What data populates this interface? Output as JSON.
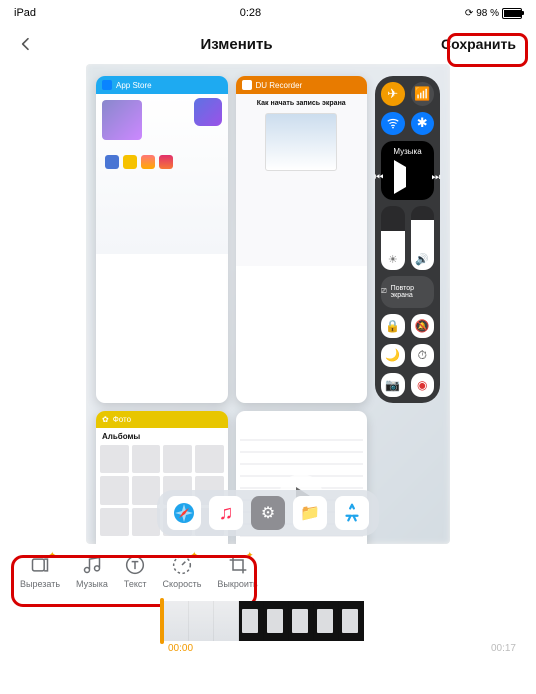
{
  "status": {
    "device": "iPad",
    "time": "0:28",
    "battery_pct": "98 %"
  },
  "nav": {
    "title": "Изменить",
    "save_label": "Сохранить"
  },
  "apps": {
    "store": "App Store",
    "recorder": "DU Recorder",
    "recorder_headline": "Как начать запись экрана",
    "photos": "Фото",
    "photos_section": "Альбомы"
  },
  "control_center": {
    "music_label": "Музыка",
    "mirror_label": "Повтор экрана"
  },
  "tools": [
    {
      "label": "Вырезать"
    },
    {
      "label": "Музыка"
    },
    {
      "label": "Текст"
    },
    {
      "label": "Скорость"
    },
    {
      "label": "Выкроить"
    }
  ],
  "timeline": {
    "start": "00:00",
    "end": "00:17"
  }
}
